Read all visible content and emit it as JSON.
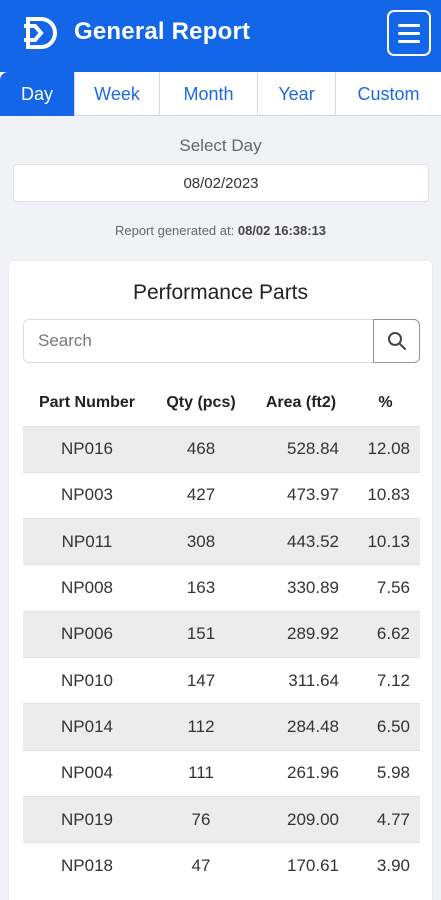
{
  "header": {
    "title": "General Report",
    "logo_icon": "logo-icon",
    "menu_icon": "hamburger-menu-icon"
  },
  "tabs": [
    {
      "label": "Day",
      "active": true
    },
    {
      "label": "Week",
      "active": false
    },
    {
      "label": "Month",
      "active": false
    },
    {
      "label": "Year",
      "active": false
    },
    {
      "label": "Custom",
      "active": false
    }
  ],
  "date_picker": {
    "label": "Select Day",
    "value": "08/02/2023"
  },
  "report": {
    "generated_prefix": "Report generated at:",
    "generated_value": "08/02 16:38:13"
  },
  "performance": {
    "title": "Performance Parts",
    "search_placeholder": "Search",
    "columns": [
      "Part Number",
      "Qty (pcs)",
      "Area (ft2)",
      "%"
    ],
    "rows": [
      [
        "NP016",
        "468",
        "528.84",
        "12.08"
      ],
      [
        "NP003",
        "427",
        "473.97",
        "10.83"
      ],
      [
        "NP011",
        "308",
        "443.52",
        "10.13"
      ],
      [
        "NP008",
        "163",
        "330.89",
        "7.56"
      ],
      [
        "NP006",
        "151",
        "289.92",
        "6.62"
      ],
      [
        "NP010",
        "147",
        "311.64",
        "7.12"
      ],
      [
        "NP014",
        "112",
        "284.48",
        "6.50"
      ],
      [
        "NP004",
        "111",
        "261.96",
        "5.98"
      ],
      [
        "NP019",
        "76",
        "209.00",
        "4.77"
      ],
      [
        "NP018",
        "47",
        "170.61",
        "3.90"
      ]
    ]
  },
  "colors": {
    "primary": "#1366e8",
    "background": "#f1f2f5",
    "row_stripe": "#ececec"
  }
}
